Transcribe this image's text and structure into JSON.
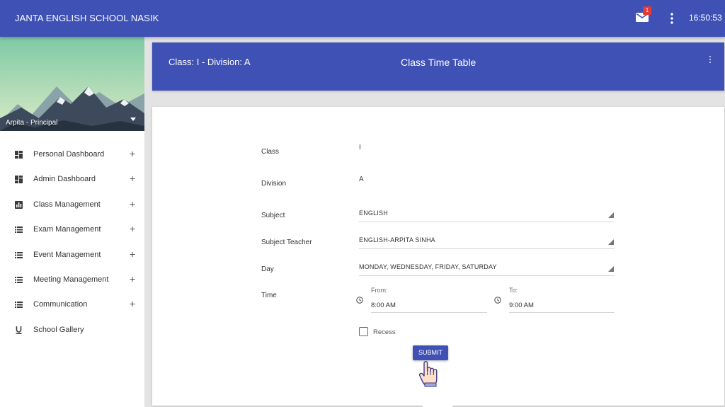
{
  "app": {
    "school_name": "JANTA ENGLISH SCHOOL NASIK",
    "notification_count": "1",
    "clock": "16:50:53",
    "icons": {
      "mail": "mail-icon",
      "menu": "more-vert-icon"
    }
  },
  "colors": {
    "primary": "#3f51b5",
    "badge": "#e53935",
    "background": "#e3e3e3"
  },
  "sidebar": {
    "user_label": "Arpita - Principal",
    "items": [
      {
        "label": "Personal Dashboard",
        "icon": "personal-dashboard-icon",
        "expandable": true
      },
      {
        "label": "Admin Dashboard",
        "icon": "admin-dashboard-icon",
        "expandable": true
      },
      {
        "label": "Class Management",
        "icon": "bar-chart-icon",
        "expandable": true
      },
      {
        "label": "Exam Management",
        "icon": "list-icon",
        "expandable": true
      },
      {
        "label": "Event Management",
        "icon": "list-icon",
        "expandable": true
      },
      {
        "label": "Meeting Management",
        "icon": "list-icon",
        "expandable": true
      },
      {
        "label": "Communication",
        "icon": "list-icon",
        "expandable": true
      },
      {
        "label": "School Gallery",
        "icon": "underline-icon",
        "expandable": false
      }
    ],
    "plus": "+"
  },
  "header": {
    "class_division": "Class: I - Division: A",
    "title": "Class Time Table"
  },
  "form": {
    "class_label": "Class",
    "class_value": "I",
    "division_label": "Division",
    "division_value": "A",
    "subject_label": "Subject",
    "subject_value": "ENGLISH",
    "teacher_label": "Subject Teacher",
    "teacher_value": "ENGLISH-ARPITA SINHA",
    "day_label": "Day",
    "day_value": "MONDAY, WEDNESDAY, FRIDAY, SATURDAY",
    "time_label": "Time",
    "from_label": "From:",
    "from_value": "8:00 AM",
    "to_label": "To:",
    "to_value": "9:00 AM",
    "recess_label": "Recess",
    "recess_checked": false,
    "submit_label": "SUBMIT"
  }
}
